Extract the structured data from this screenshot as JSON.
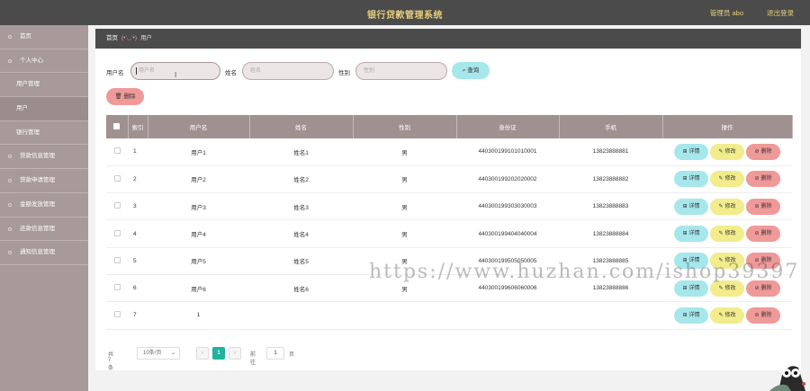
{
  "header": {
    "title": "银行贷款管理系统",
    "admin": "管理员 abo",
    "logout": "退出登录"
  },
  "sidebar": {
    "items": [
      {
        "label": "首页",
        "type": "top"
      },
      {
        "label": "个人中心",
        "type": "top"
      },
      {
        "label": "用户管理",
        "type": "sub"
      },
      {
        "label": "用户",
        "type": "active"
      },
      {
        "label": "银行管理",
        "type": "sub"
      },
      {
        "label": "贷款信息管理",
        "type": "top"
      },
      {
        "label": "贷款申请管理",
        "type": "top"
      },
      {
        "label": "金额发放管理",
        "type": "top"
      },
      {
        "label": "还款信息管理",
        "type": "top"
      },
      {
        "label": "通知信息管理",
        "type": "top"
      }
    ]
  },
  "breadcrumb": {
    "home": "首页",
    "face": "(•'◡'•)",
    "current": "用户"
  },
  "search": {
    "username_label": "用户名",
    "username_placeholder": "用户名",
    "name_label": "姓名",
    "name_placeholder": "姓名",
    "gender_label": "性别",
    "gender_placeholder": "性别",
    "search_button": "查询",
    "delete_button": "删除"
  },
  "table": {
    "headers": [
      "索引",
      "用户名",
      "姓名",
      "性别",
      "身份证",
      "手机",
      "操作"
    ],
    "actions": {
      "detail": "详情",
      "edit": "修改",
      "delete": "删除"
    },
    "rows": [
      {
        "index": "1",
        "username": "用户1",
        "name": "姓名1",
        "gender": "男",
        "idcard": "440300199101010001",
        "phone": "13823888881"
      },
      {
        "index": "2",
        "username": "用户2",
        "name": "姓名2",
        "gender": "男",
        "idcard": "440300199202020002",
        "phone": "13823888882"
      },
      {
        "index": "3",
        "username": "用户3",
        "name": "姓名3",
        "gender": "男",
        "idcard": "440300199303030003",
        "phone": "13823888883"
      },
      {
        "index": "4",
        "username": "用户4",
        "name": "姓名4",
        "gender": "男",
        "idcard": "440300199404040004",
        "phone": "13823888884"
      },
      {
        "index": "5",
        "username": "用户5",
        "name": "姓名5",
        "gender": "男",
        "idcard": "440300199505050005",
        "phone": "13823888885"
      },
      {
        "index": "6",
        "username": "用户6",
        "name": "姓名6",
        "gender": "男",
        "idcard": "440300199606060006",
        "phone": "13823888886"
      },
      {
        "index": "7",
        "username": "1",
        "name": "",
        "gender": "",
        "idcard": "",
        "phone": ""
      }
    ]
  },
  "pagination": {
    "total": "共 7 条",
    "page_size": "10条/页",
    "current": "1",
    "goto_label": "前往",
    "goto_value": "1",
    "page_unit": "页"
  },
  "watermark": "https://www.huzhan.com/ishop39397"
}
